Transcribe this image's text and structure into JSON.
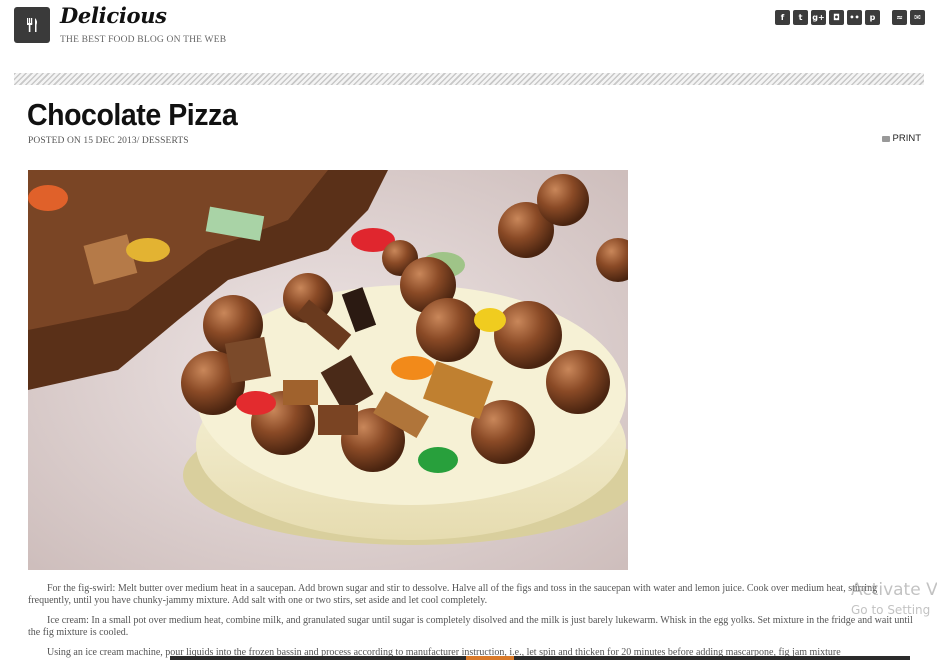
{
  "site": {
    "title": "Delicious",
    "tagline": "THE BEST FOOD BLOG ON THE WEB",
    "logo_icon": "fork-knife-icon"
  },
  "social": [
    {
      "name": "facebook-icon",
      "glyph": "f"
    },
    {
      "name": "twitter-icon",
      "glyph": "t"
    },
    {
      "name": "google-plus-icon",
      "glyph": "g+"
    },
    {
      "name": "instagram-icon",
      "glyph": "◘"
    },
    {
      "name": "flickr-icon",
      "glyph": "••"
    },
    {
      "name": "pinterest-icon",
      "glyph": "p"
    },
    {
      "name": "rss-icon",
      "glyph": "≈"
    },
    {
      "name": "mail-icon",
      "glyph": "✉"
    }
  ],
  "post": {
    "title": "Chocolate Pizza",
    "meta": "POSTED ON 15 DEC 2013/ DESSERTS",
    "print_label": "PRINT",
    "paragraphs": [
      "For the fig-swirl: Melt butter over medium heat in a saucepan. Add brown sugar and stir to dessolve. Halve all of the figs and toss in the saucepan with water and lemon juice. Cook over medium heat, stirring frequently, until you have chunky-jammy mixture. Add salt with one or two stirs, set aside and let cool completely.",
      "Ice cream: In a small pot over medium heat, combine milk, and granulated sugar until sugar is completely disolved and the milk is just barely lukewarm. Whisk in the egg yolks. Set mixture in the fridge and wait until the fig mixture is cooled.",
      "Using an ice cream machine, pour liquids into the frozen bassin and process according to manufacturer instruction, i.e., let spin and thicken for 20 minutes before adding mascarpone, fig jam mixture"
    ]
  },
  "watermark": {
    "line1": "Activate V",
    "line2": "Go to Setting"
  }
}
